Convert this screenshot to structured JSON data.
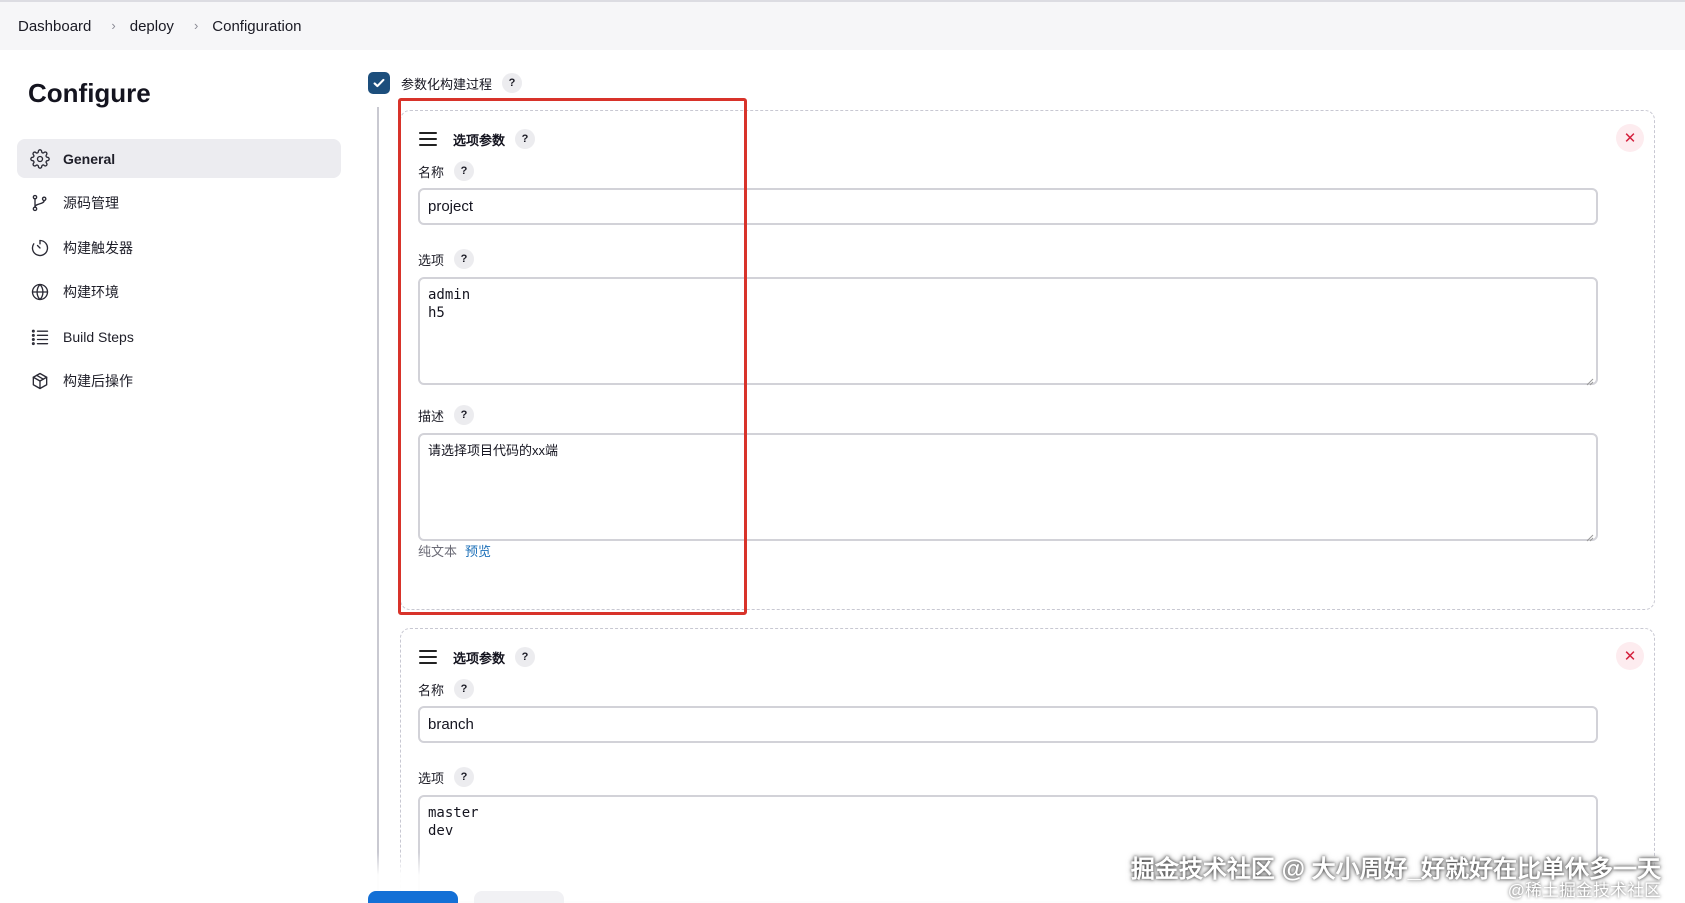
{
  "breadcrumb": [
    "Dashboard",
    "deploy",
    "Configuration"
  ],
  "page_title": "Configure",
  "nav": [
    {
      "label": "General",
      "icon": "gear-icon",
      "active": true
    },
    {
      "label": "源码管理",
      "icon": "branch-icon",
      "active": false
    },
    {
      "label": "构建触发器",
      "icon": "clock-icon",
      "active": false
    },
    {
      "label": "构建环境",
      "icon": "globe-icon",
      "active": false
    },
    {
      "label": "Build Steps",
      "icon": "list-icon",
      "active": false
    },
    {
      "label": "构建后操作",
      "icon": "package-icon",
      "active": false
    }
  ],
  "param_toggle": {
    "label": "参数化构建过程",
    "checked": true,
    "help": "?"
  },
  "params": [
    {
      "type_label": "选项参数",
      "name_label": "名称",
      "name_value": "project",
      "choices_label": "选项",
      "choices": [
        "admin",
        "h5"
      ],
      "desc_label": "描述",
      "desc_value": "请选择项目代码的xx端",
      "format_label": "纯文本",
      "preview_label": "预览"
    },
    {
      "type_label": "选项参数",
      "name_label": "名称",
      "name_value": "branch",
      "choices_label": "选项",
      "choices": [
        "master",
        "dev"
      ]
    }
  ],
  "watermark": {
    "main": "掘金技术社区 @ 大小周好_好就好在比单休多一天",
    "small": "@稀土掘金技术社区"
  },
  "colors": {
    "accent": "#1c4e7c",
    "highlight": "#d8332a",
    "close": "#d4213d",
    "link": "#1b6fb8",
    "primary_button": "#1470d6"
  }
}
